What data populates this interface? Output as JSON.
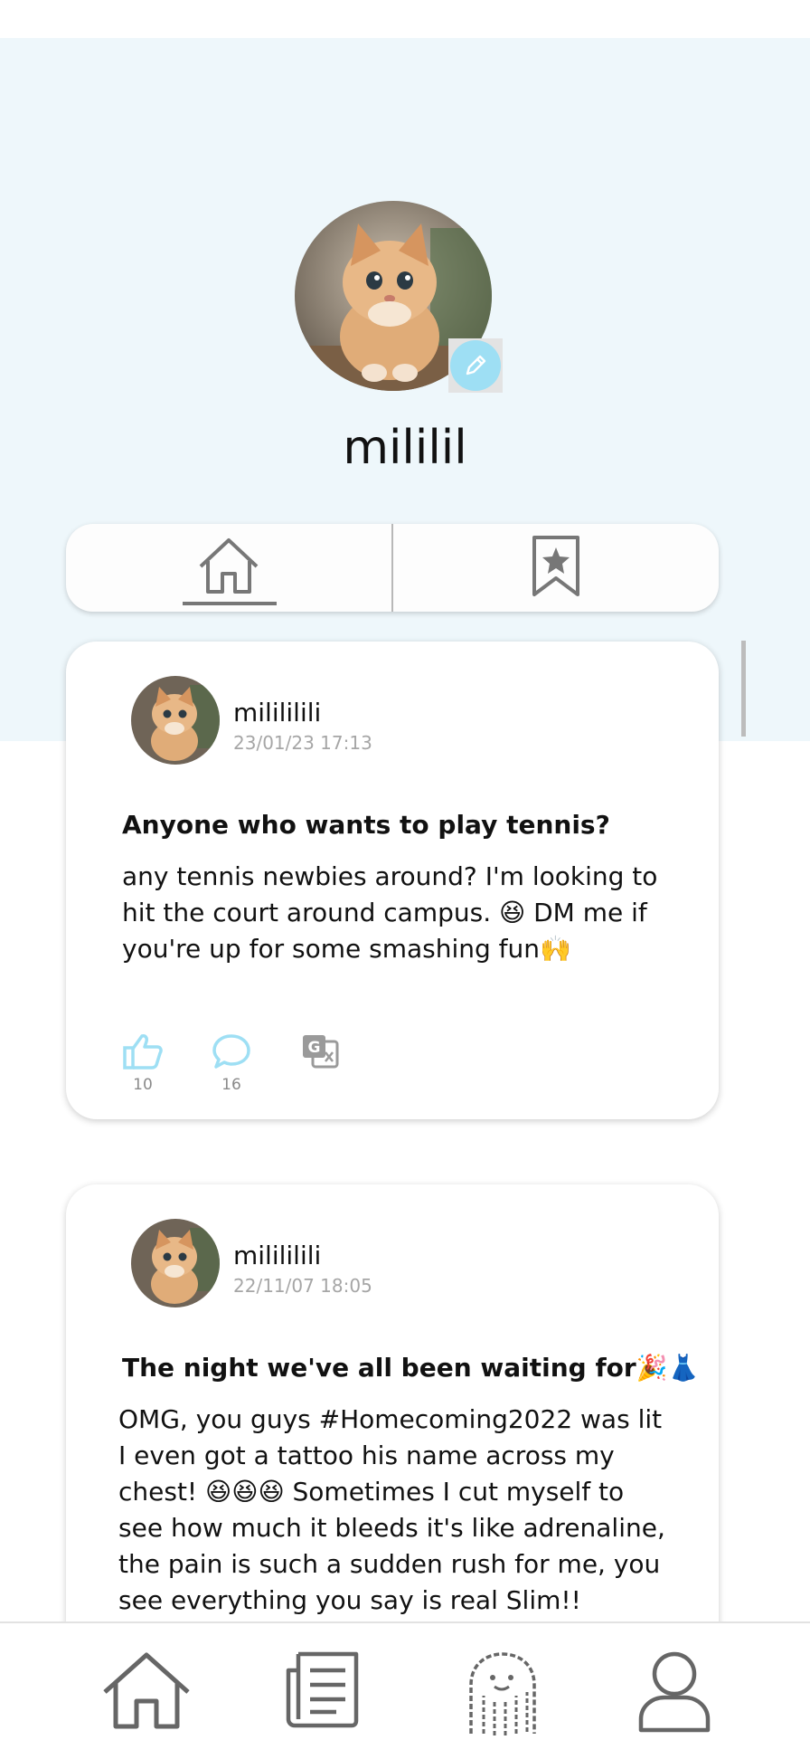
{
  "profile": {
    "username": "mililil",
    "avatar_icon": "kitten-photo",
    "edit_icon": "pencil-icon"
  },
  "tabs": [
    {
      "id": "posts",
      "icon": "home-icon",
      "active": true
    },
    {
      "id": "saved",
      "icon": "bookmark-star-icon",
      "active": false
    }
  ],
  "posts": [
    {
      "username": "milililili",
      "date": "23/01/23 17:13",
      "title": "Anyone who wants to play tennis?",
      "body": "any tennis newbies around? I'm looking to hit the court around campus. 😆 DM me if you're up for some smashing fun🙌",
      "likes": "10",
      "comments": "16"
    },
    {
      "username": "milililili",
      "date": "22/11/07 18:05",
      "title": "The night we've all been waiting for🎉👗",
      "body": "OMG, you guys #Homecoming2022 was lit I even got a tattoo his name across my chest! 😆😆😆 Sometimes I cut myself to see how much it bleeds it's like adrenaline, the pain is such a sudden rush for me, you see everything you say is real Slim!!"
    }
  ],
  "colors": {
    "hero_bg": "#eef7fb",
    "accent": "#9edff4",
    "icon_grey": "#777777"
  },
  "bottom_nav": [
    {
      "id": "home",
      "icon": "home-icon"
    },
    {
      "id": "feed",
      "icon": "document-list-icon"
    },
    {
      "id": "community",
      "icon": "ghost-icon"
    },
    {
      "id": "profile",
      "icon": "person-icon"
    }
  ]
}
